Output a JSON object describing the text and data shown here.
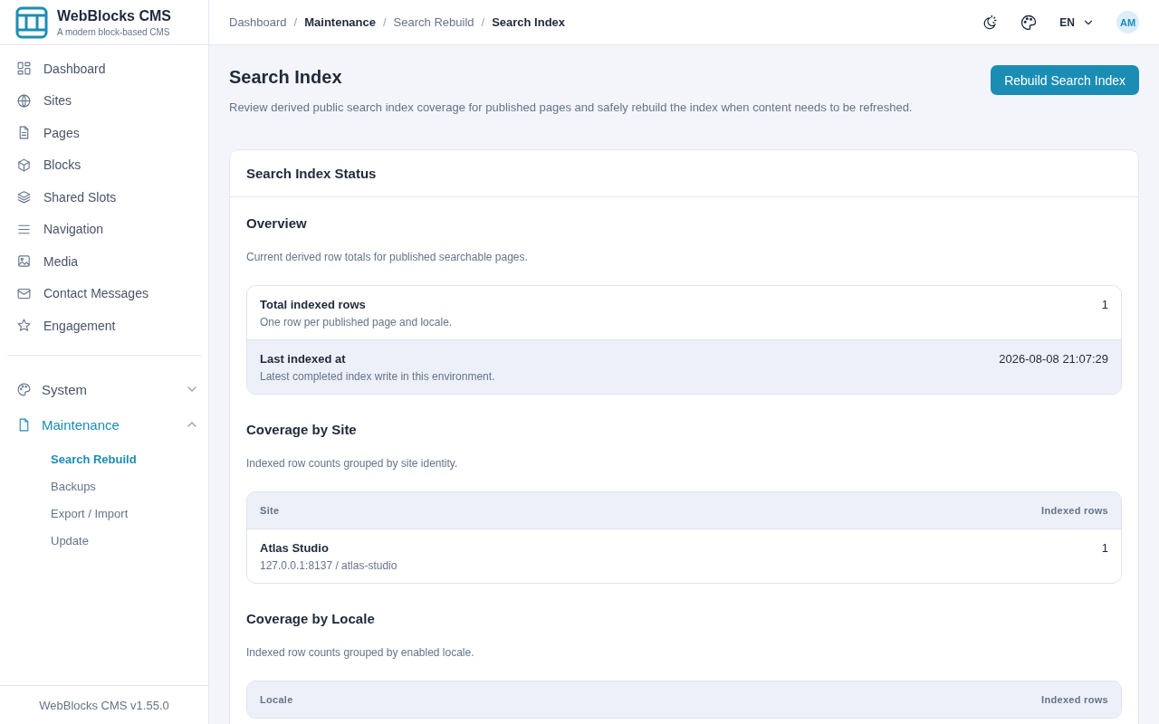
{
  "brand": {
    "title": "WebBlocks CMS",
    "subtitle": "A modern block-based CMS"
  },
  "nav": [
    {
      "label": "Dashboard"
    },
    {
      "label": "Sites"
    },
    {
      "label": "Pages"
    },
    {
      "label": "Blocks"
    },
    {
      "label": "Shared Slots"
    },
    {
      "label": "Navigation"
    },
    {
      "label": "Media"
    },
    {
      "label": "Contact Messages"
    },
    {
      "label": "Engagement"
    }
  ],
  "groups": [
    {
      "label": "System",
      "expanded": false,
      "selected": false
    },
    {
      "label": "Maintenance",
      "expanded": true,
      "selected": true,
      "children": [
        {
          "label": "Search Rebuild",
          "selected": true
        },
        {
          "label": "Backups",
          "selected": false
        },
        {
          "label": "Export / Import",
          "selected": false
        },
        {
          "label": "Update",
          "selected": false
        }
      ]
    }
  ],
  "footer": "WebBlocks CMS v1.55.0",
  "breadcrumbs": [
    {
      "label": "Dashboard",
      "emphasis": false
    },
    {
      "separator": "/",
      "label": "Maintenance",
      "emphasis": true
    },
    {
      "separator": "/",
      "label": "Search Rebuild",
      "emphasis": false
    },
    {
      "separator": "/",
      "label": "Search Index",
      "emphasis": true
    }
  ],
  "topbar": {
    "language": "EN",
    "avatar": "AM"
  },
  "page": {
    "title": "Search Index",
    "description": "Review derived public search index coverage for published pages and safely rebuild the index when content needs to be refreshed.",
    "action": "Rebuild Search Index"
  },
  "card": {
    "title": "Search Index Status",
    "overview": {
      "title": "Overview",
      "description": "Current derived row totals for published searchable pages.",
      "rows": [
        {
          "label": "Total indexed rows",
          "hint": "One row per published page and locale.",
          "value": "1",
          "highlighted": false
        },
        {
          "label": "Last indexed at",
          "hint": "Latest completed index write in this environment.",
          "value": "2026-08-08 21:07:29",
          "highlighted": true
        }
      ]
    },
    "tables": [
      {
        "title": "Coverage by Site",
        "description": "Indexed row counts grouped by site identity.",
        "columns": [
          "Site",
          "Indexed rows"
        ],
        "rows": [
          {
            "name": "Atlas Studio",
            "detail": "127.0.0.1:8137 / atlas-studio",
            "value": "1"
          }
        ]
      },
      {
        "title": "Coverage by Locale",
        "description": "Indexed row counts grouped by enabled locale.",
        "columns": [
          "Locale",
          "Indexed rows"
        ]
      }
    ]
  }
}
